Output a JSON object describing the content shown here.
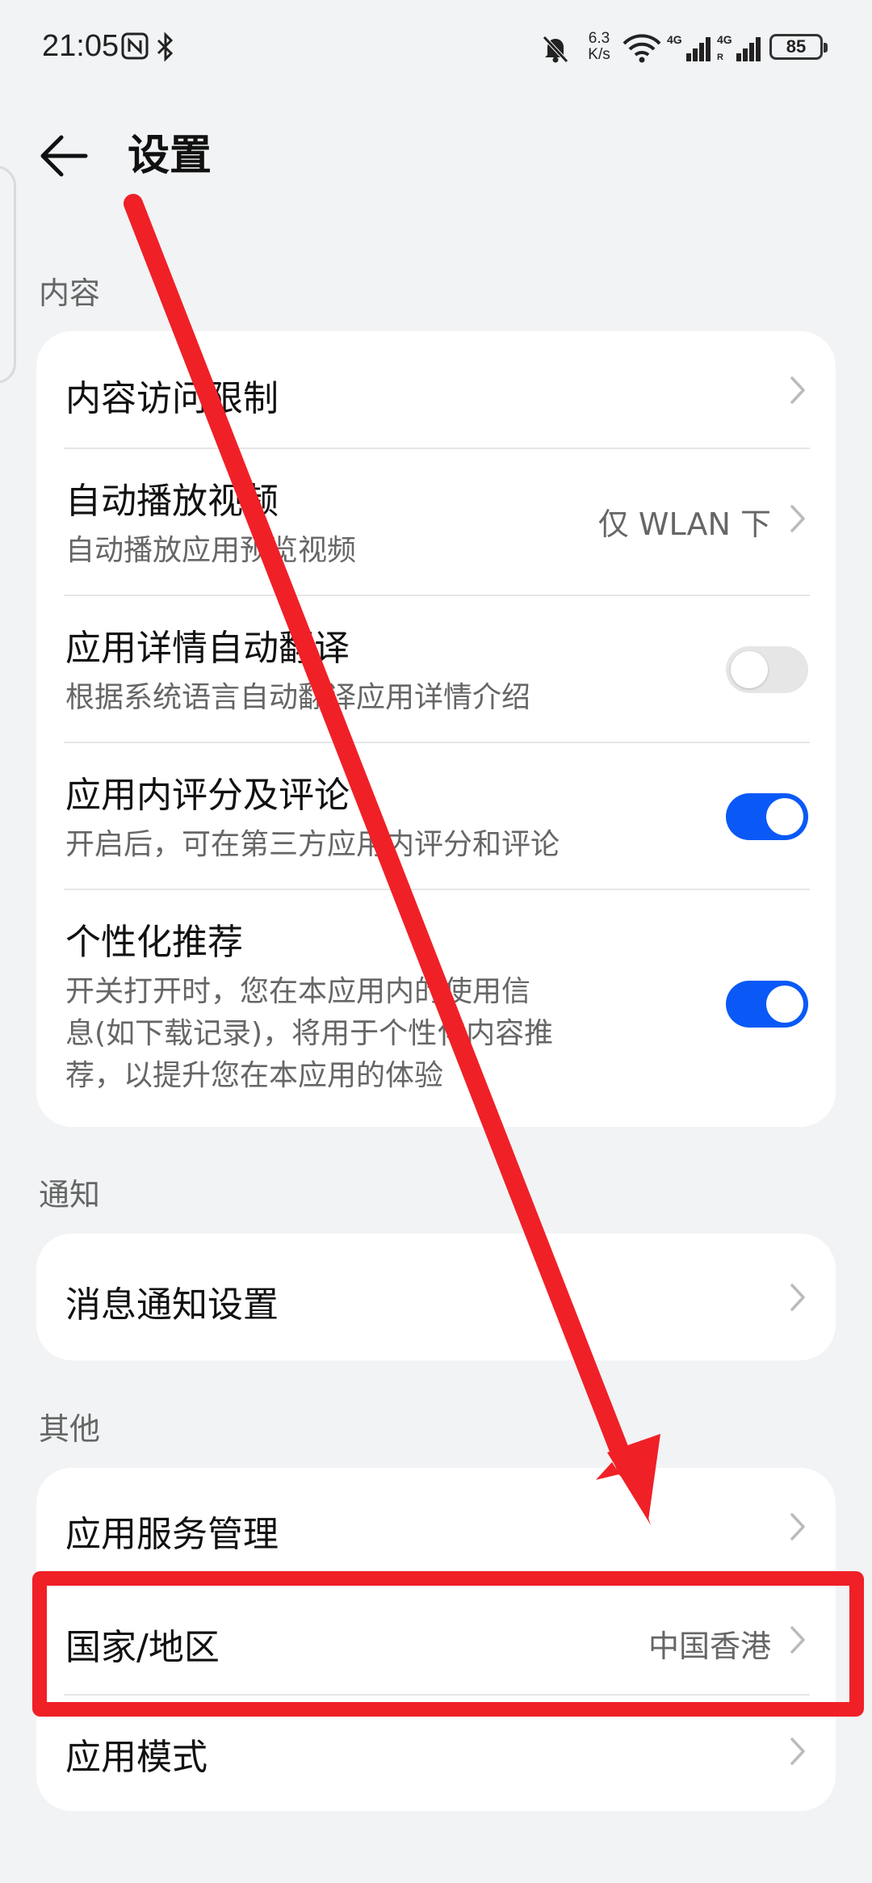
{
  "status_bar": {
    "time": "21:05",
    "net_speed_value": "6.3",
    "net_speed_unit": "K/s",
    "battery": "85"
  },
  "header": {
    "title": "设置"
  },
  "sections": [
    {
      "title": "内容",
      "items": [
        {
          "label": "内容访问限制"
        },
        {
          "label": "自动播放视频",
          "sub": "自动播放应用预览视频",
          "value": "仅 WLAN 下"
        },
        {
          "label": "应用详情自动翻译",
          "sub": "根据系统语言自动翻译应用详情介绍",
          "toggle": false
        },
        {
          "label": "应用内评分及评论",
          "sub": "开启后，可在第三方应用内评分和评论",
          "toggle": true
        },
        {
          "label": "个性化推荐",
          "sub_lines": [
            "开关打开时，您在本应用内的使用信",
            "息(如下载记录)，将用于个性化内容推",
            "荐，以提升您在本应用的体验"
          ],
          "toggle": true
        }
      ]
    },
    {
      "title": "通知",
      "items": [
        {
          "label": "消息通知设置"
        }
      ]
    },
    {
      "title": "其他",
      "items": [
        {
          "label": "应用服务管理"
        },
        {
          "label": "国家/地区",
          "value": "中国香港"
        },
        {
          "label": "应用模式"
        }
      ]
    }
  ],
  "colors": {
    "accent": "#0a59f7",
    "annotation": "#f02027",
    "background": "#f1f3f5"
  }
}
